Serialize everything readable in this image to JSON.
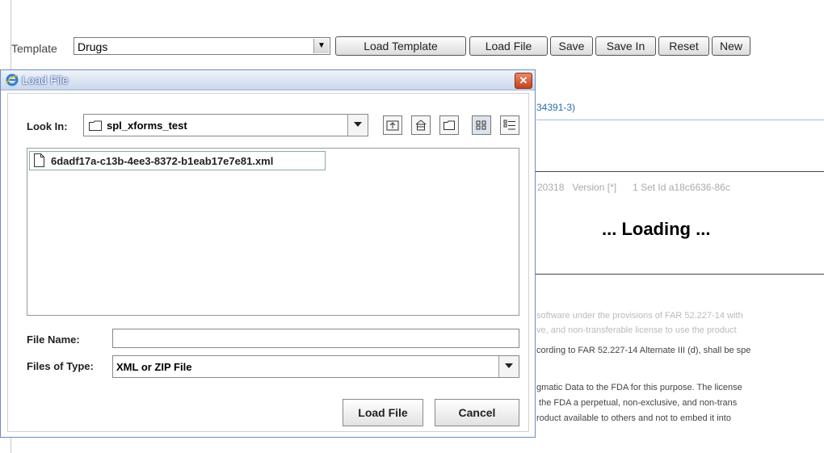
{
  "toolbar": {
    "template_label": "Template",
    "template_value": "Drugs",
    "buttons": [
      "Load Template",
      "Load File",
      "Save",
      "Save In",
      "Reset",
      "New"
    ]
  },
  "background": {
    "id_fragment": "34391-3)",
    "version_text": "20318   Version [*]      1 Set Id a18c6636-86c",
    "loading_text": "... Loading ...",
    "lines": [
      "software under the provisions of FAR 52.227-14 with",
      "ve, and non-transferable license to use the product",
      "cording to FAR 52.227-14 Alternate III (d), shall be spe",
      "gmatic Data to the FDA for this purpose. The license",
      " the FDA a perpetual, non-exclusive, and non-trans",
      "roduct available to others and not to embed it into"
    ]
  },
  "dialog": {
    "title": "Load File",
    "close_glyph": "✕",
    "look_in_label": "Look In:",
    "look_in_value": "spl_xforms_test",
    "files": [
      "6dadf17a-c13b-4ee3-8372-b1eab17e7e81.xml"
    ],
    "file_name_label": "File Name:",
    "file_name_value": "",
    "files_of_type_label": "Files of Type:",
    "files_of_type_value": "XML or ZIP File",
    "load_button": "Load File",
    "cancel_button": "Cancel"
  },
  "colors": {
    "accent_link": "#2a6fb0",
    "dialog_border": "#6b8cc4",
    "close_red": "#c6421d"
  },
  "icons": [
    "folder-icon",
    "up-folder-icon",
    "home-icon",
    "new-folder-icon",
    "list-view-icon",
    "details-view-icon",
    "file-icon",
    "ie-icon"
  ]
}
